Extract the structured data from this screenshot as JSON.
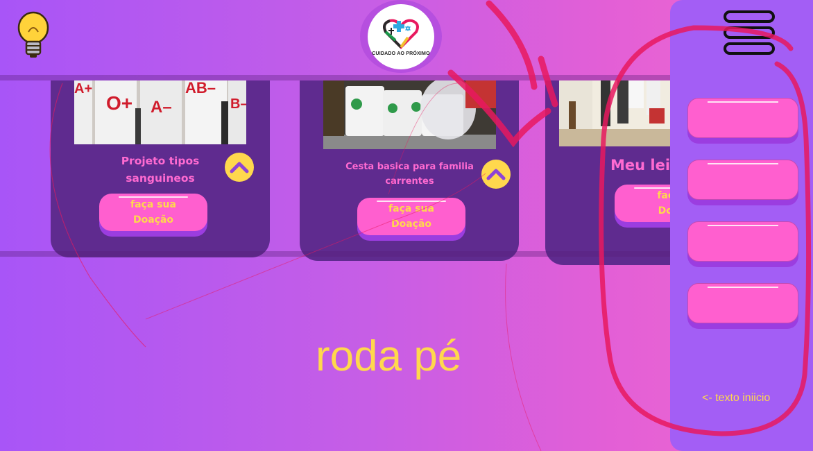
{
  "header": {
    "logo_caption": "CUIDADO AO PRÓXIMO"
  },
  "cards": [
    {
      "title_line1": "Projeto tipos",
      "title_line2": "sanguineos",
      "donate_line1": "faça sua",
      "donate_line2": "Doação",
      "photo_labels": [
        "A+",
        "O+",
        "A–",
        "AB–",
        "B–"
      ]
    },
    {
      "title_line1": "Cesta basica para  familia",
      "title_line2": "carrentes",
      "donate_line1": "faça sua",
      "donate_line2": "Doação"
    },
    {
      "title_line1": "Meu leit",
      "donate_line1": "faça",
      "donate_line2": "Doa"
    }
  ],
  "footer": {
    "text": "roda pé"
  },
  "side_panel": {
    "note": "<-  texto iniicio"
  },
  "colors": {
    "card_bg": "#5f2b8f",
    "button_pink": "#ff5fcf",
    "accent_yellow": "#ffd84d",
    "panel_bg": "#a35ef5",
    "scribble_red": "#e8195f"
  }
}
